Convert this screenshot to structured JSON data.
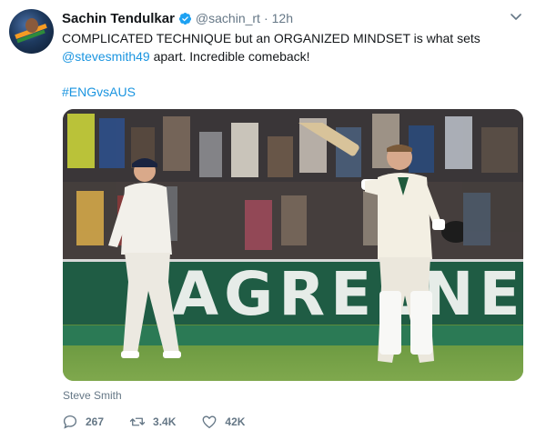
{
  "tweet": {
    "author_name": "Sachin Tendulkar",
    "handle": "@sachin_rt",
    "separator": "·",
    "time": "12h",
    "text_line1": "COMPLICATED TECHNIQUE but an ORGANIZED MINDSET is what sets",
    "mention": "@stevesmith49",
    "text_line2_rest": " apart. Incredible comeback!",
    "hashtag": "#ENGvsAUS",
    "media": {
      "board_text": "AGREENE",
      "caption": "Steve Smith"
    },
    "actions": {
      "replies": "267",
      "retweets": "3.4K",
      "likes": "42K"
    },
    "icons": {
      "verified": "verified-badge-icon",
      "caret": "chevron-down-icon",
      "reply": "reply-icon",
      "retweet": "retweet-icon",
      "like": "heart-icon"
    },
    "colors": {
      "link": "#1b95e0",
      "secondary_text": "#657786",
      "primary_text": "#14171a"
    }
  }
}
